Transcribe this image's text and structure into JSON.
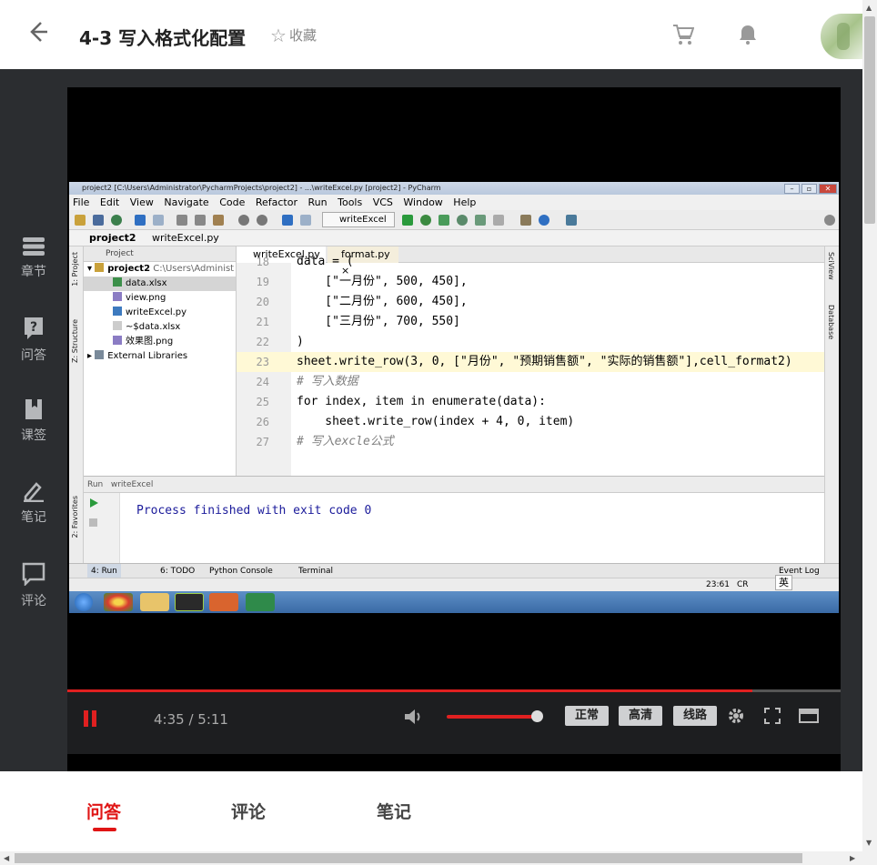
{
  "header": {
    "back_icon": "back-arrow-icon",
    "title": "4-3 写入格式化配置",
    "favorite_label": "收藏"
  },
  "nav": {
    "items": [
      {
        "icon": "chapters-icon",
        "label": "章节"
      },
      {
        "icon": "qa-icon",
        "label": "问答"
      },
      {
        "icon": "bookmark-icon",
        "label": "课签"
      },
      {
        "icon": "note-icon",
        "label": "笔记"
      },
      {
        "icon": "comment-icon",
        "label": "评论"
      }
    ]
  },
  "ide": {
    "window_title": "project2 [C:\\Users\\Administrator\\PycharmProjects\\project2] - ...\\writeExcel.py [project2] - PyCharm",
    "menu": [
      "File",
      "Edit",
      "View",
      "Navigate",
      "Code",
      "Refactor",
      "Run",
      "Tools",
      "VCS",
      "Window",
      "Help"
    ],
    "run_config": "writeExcel",
    "breadcrumb": [
      "project2",
      "writeExcel.py"
    ],
    "left_tabs": [
      "1: Project",
      "Z: Structure",
      "2: Favorites"
    ],
    "right_tabs": [
      "SciView",
      "Database"
    ],
    "project_header": "Project",
    "tree": [
      {
        "label": "project2",
        "extra": "C:\\Users\\Administ"
      },
      {
        "label": "data.xlsx"
      },
      {
        "label": "view.png"
      },
      {
        "label": "writeExcel.py"
      },
      {
        "label": "~$data.xlsx"
      },
      {
        "label": "效果图.png"
      },
      {
        "label": "External Libraries"
      }
    ],
    "tabs": [
      "writeExcel.py",
      "format.py"
    ],
    "code": [
      {
        "num": "18",
        "text": "data = ("
      },
      {
        "num": "19",
        "text": "    [\"一月份\", 500, 450],"
      },
      {
        "num": "20",
        "text": "    [\"二月份\", 600, 450],"
      },
      {
        "num": "21",
        "text": "    [\"三月份\", 700, 550]"
      },
      {
        "num": "22",
        "text": ")"
      },
      {
        "num": "23",
        "text": "sheet.write_row(3, 0, [\"月份\", \"预期销售额\", \"实际的销售额\"],cell_format2)"
      },
      {
        "num": "24",
        "text": "# 写入数据"
      },
      {
        "num": "25",
        "text": "for index, item in enumerate(data):"
      },
      {
        "num": "26",
        "text": "    sheet.write_row(index + 4, 0, item)"
      },
      {
        "num": "27",
        "text": "# 写入excle公式"
      }
    ],
    "run_header": "Run",
    "run_name": "writeExcel",
    "output": "Process finished with exit code 0",
    "bottom_tabs": [
      "4: Run",
      "6: TODO",
      "Python Console",
      "Terminal"
    ],
    "event_log": "Event Log",
    "status_pos": "23:61",
    "status_crlf": "CR",
    "ime": "英"
  },
  "player": {
    "time": "4:35 / 5:11",
    "progress": 0.886,
    "volume": 0.8,
    "quality_normal": "正常",
    "quality_hd": "高清",
    "route": "线路"
  },
  "bottom_tabs": [
    "问答",
    "评论",
    "笔记"
  ]
}
